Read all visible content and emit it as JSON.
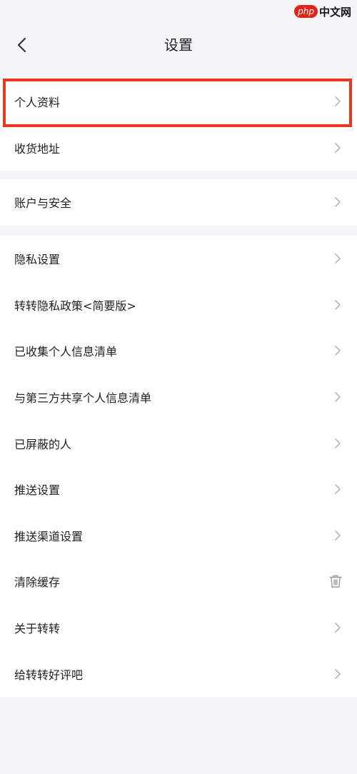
{
  "watermark": {
    "logo": "php",
    "text": "中文网"
  },
  "header": {
    "title": "设置",
    "back_icon": "chevron-left-icon"
  },
  "groups": [
    {
      "items": [
        {
          "label": "个人资料",
          "icon": "chevron-right-icon",
          "highlighted": true
        },
        {
          "label": "收货地址",
          "icon": "chevron-right-icon"
        }
      ]
    },
    {
      "items": [
        {
          "label": "账户与安全",
          "icon": "chevron-right-icon"
        }
      ]
    },
    {
      "items": [
        {
          "label": "隐私设置",
          "icon": "chevron-right-icon"
        },
        {
          "label": "转转隐私政策<简要版>",
          "icon": "chevron-right-icon"
        },
        {
          "label": "已收集个人信息清单",
          "icon": "chevron-right-icon"
        },
        {
          "label": "与第三方共享个人信息清单",
          "icon": "chevron-right-icon"
        },
        {
          "label": "已屏蔽的人",
          "icon": "chevron-right-icon"
        },
        {
          "label": "推送设置",
          "icon": "chevron-right-icon"
        },
        {
          "label": "推送渠道设置",
          "icon": "chevron-right-icon"
        },
        {
          "label": "清除缓存",
          "icon": "trash-icon"
        },
        {
          "label": "关于转转",
          "icon": "chevron-right-icon"
        },
        {
          "label": "给转转好评吧",
          "icon": "chevron-right-icon"
        }
      ]
    }
  ],
  "colors": {
    "background": "#f5f5f7",
    "card": "#ffffff",
    "highlight_border": "#e8371c",
    "icon": "#b5b5b5"
  }
}
